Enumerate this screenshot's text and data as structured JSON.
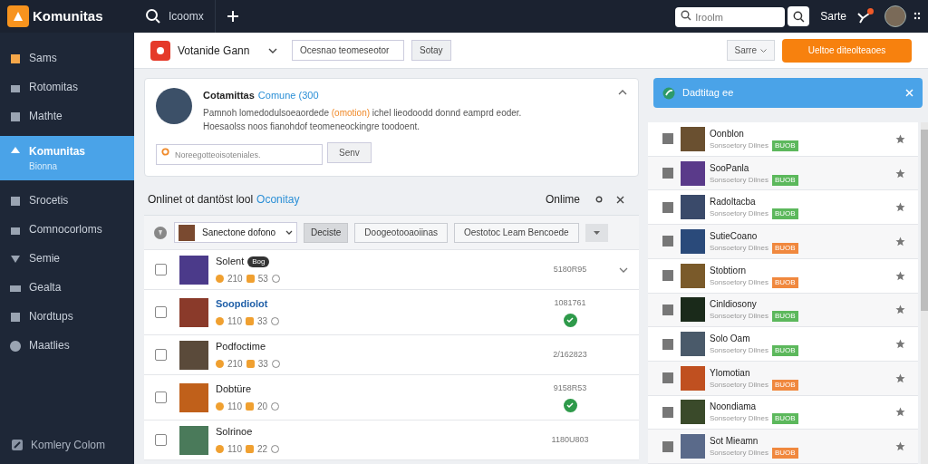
{
  "topbar": {
    "logo": "Komunitas",
    "search_label": "Icoomx",
    "search_placeholder": "Iroolm",
    "user_label": "Sarte",
    "notification": true
  },
  "sidebar": {
    "items": [
      {
        "label": "Sams",
        "selected": false
      },
      {
        "label": "Rotomitas",
        "selected": false
      },
      {
        "label": "Mathte",
        "selected": false
      },
      {
        "label": "Komunitas",
        "sublabel": "Bionna",
        "selected": true
      },
      {
        "label": "Srocetis",
        "selected": false
      },
      {
        "label": "Comnocorloms",
        "selected": false
      },
      {
        "label": "Semie",
        "selected": false
      },
      {
        "label": "Gealta",
        "selected": false
      },
      {
        "label": "Nordtups",
        "selected": false
      },
      {
        "label": "Maatlies",
        "selected": false
      }
    ],
    "footer": "Komlery Colom"
  },
  "toolbar": {
    "game_select": "Votanide Gann",
    "filter_placeholder": "Ocesnao teomeseotor",
    "filter_button": "Sotay",
    "sort_select": "Sarre",
    "primary_button": "Ueltoe diteolteaoes"
  },
  "community": {
    "title": "Cotamittas",
    "title_link": "Comune (300",
    "description_before": "Pamnoh lomedodulsoeaordede",
    "description_highlight": "(omotion)",
    "description_after": "ichel lieodoodd donnd eamprd eoder.",
    "description_line2": "Hoesaolss noos fianohdof teomeneockingre toodoent.",
    "search_placeholder": "Noreegotteoisoteniales.",
    "search_button": "Senv",
    "expanded": true
  },
  "list": {
    "title": "Onlinet ot dantöst lool",
    "title_link": "Oconitay",
    "status": "Onlime",
    "filters": {
      "select": "Sanectone dofono",
      "buttons": [
        {
          "label": "Deciste",
          "selected": true
        },
        {
          "label": "Doogeotooaoiinas",
          "selected": false
        },
        {
          "label": "Oestotoc Leam Bencoede",
          "selected": false
        }
      ]
    },
    "rows": [
      {
        "name": "Solent",
        "badge": "Bog",
        "linked": false,
        "stat_1": "210",
        "stat_2": "53",
        "date": "5180R95",
        "verified": false,
        "checked": false,
        "expandable": true
      },
      {
        "name": "Soopdiolot",
        "linked": true,
        "stat_1": "110",
        "stat_2": "33",
        "date": "1081761",
        "verified": true,
        "checked": false,
        "expandable": false
      },
      {
        "name": "Podfoctime",
        "linked": false,
        "stat_1": "210",
        "stat_2": "33",
        "date": "2/162823",
        "verified": false,
        "checked": false,
        "expandable": false
      },
      {
        "name": "Dobtüre",
        "linked": false,
        "stat_1": "110",
        "stat_2": "20",
        "date": "9158R53",
        "verified": true,
        "checked": false,
        "expandable": false
      },
      {
        "name": "Solrinoe",
        "linked": false,
        "stat_1": "110",
        "stat_2": "22",
        "date": "1180U803",
        "verified": false,
        "checked": false,
        "expandable": false
      }
    ]
  },
  "side_panel": {
    "banner": "Dadtitag ee",
    "items": [
      {
        "name": "Oonblon",
        "sub": "Sonsoetory Dilnes",
        "tag": "BUOB",
        "color": "#5cb85c"
      },
      {
        "name": "SooPanla",
        "sub": "Sonsoetory Dilnes",
        "tag": "BUOB",
        "color": "#5cb85c"
      },
      {
        "name": "Radoltacba",
        "sub": "Sonsoetory Dilnes",
        "tag": "BUOB",
        "color": "#5cb85c"
      },
      {
        "name": "SutieCoano",
        "sub": "Sonsoetory Dilnes",
        "tag": "BUOB",
        "color": "#f0883e"
      },
      {
        "name": "Stobtiorn",
        "sub": "Sonsoetory Dilnes",
        "tag": "BUOB",
        "color": "#f0883e"
      },
      {
        "name": "Cinldiosony",
        "sub": "Sonsoetory Dilnes",
        "tag": "BUOB",
        "color": "#5cb85c"
      },
      {
        "name": "Solo Oam",
        "sub": "Sonsoetory Dilnes",
        "tag": "BUOB",
        "color": "#5cb85c"
      },
      {
        "name": "Ylomotian",
        "sub": "Sonsoetory Dilnes",
        "tag": "BUOB",
        "color": "#f0883e"
      },
      {
        "name": "Noondiama",
        "sub": "Sonsoetory Dilnes",
        "tag": "BUOB",
        "color": "#5cb85c"
      },
      {
        "name": "Sot Mieamn",
        "sub": "Sonsoetory Dilnes",
        "tag": "BUOB",
        "color": "#f0883e"
      }
    ]
  }
}
